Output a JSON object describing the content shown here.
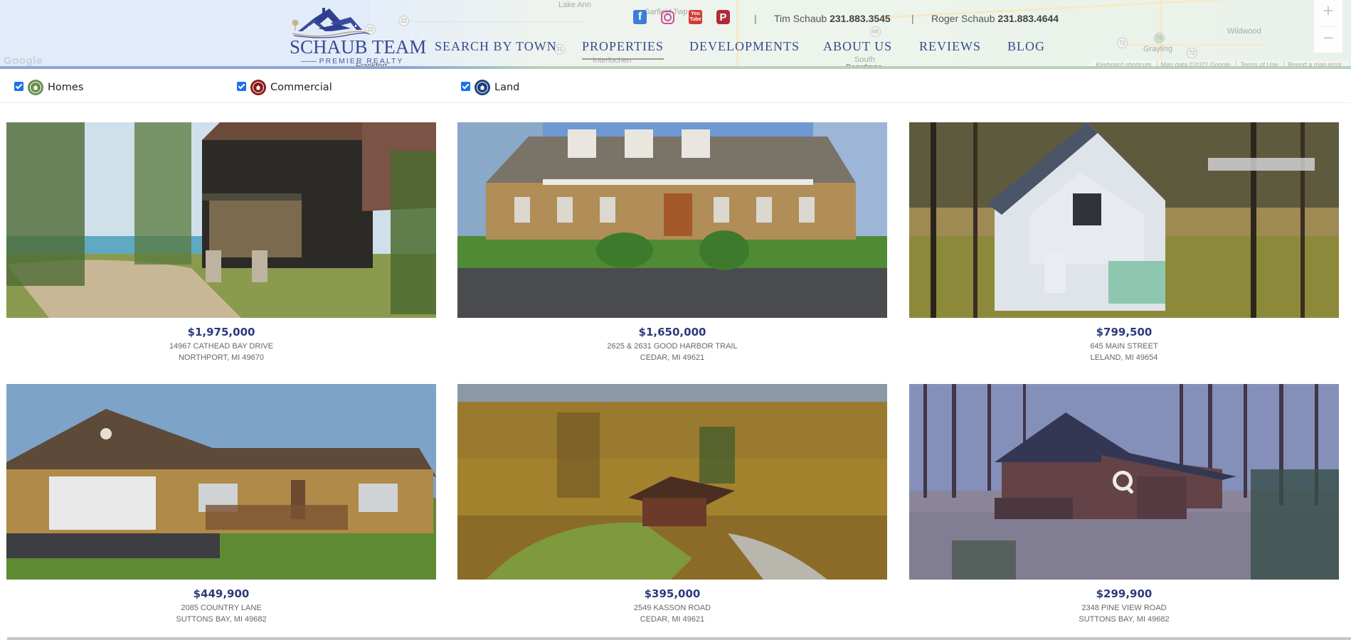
{
  "map": {
    "labels": [
      "Lake Ann",
      "Garfield Twp",
      "Interlochen",
      "Frankfort",
      "South",
      "Boardman",
      "Grayling",
      "Wildwood"
    ],
    "routes": [
      "22",
      "22",
      "31",
      "66",
      "72",
      "72",
      "75"
    ],
    "zoom_in": "+",
    "zoom_out": "−",
    "attribution": [
      "Keyboard shortcuts",
      "Map data ©2022 Google",
      "Terms of Use",
      "Report a map error"
    ],
    "provider_logo": "Google"
  },
  "brand": {
    "title": "SCHAUB TEAM",
    "subtitle": "PREMIER REALTY",
    "primary_color": "#3a4a8e"
  },
  "social": [
    {
      "name": "facebook",
      "glyph": "f",
      "color": "#3b7dd8"
    },
    {
      "name": "instagram",
      "glyph": "",
      "color": "#c94e9c"
    },
    {
      "name": "youtube",
      "glyph": "You Tube",
      "color": "#d23b33"
    },
    {
      "name": "pinterest",
      "glyph": "P",
      "color": "#b02a3a"
    }
  ],
  "contacts": [
    {
      "name": "Tim Schaub",
      "phone": "231.883.3545"
    },
    {
      "name": "Roger Schaub",
      "phone": "231.883.4644"
    }
  ],
  "separator": "|",
  "nav": [
    {
      "label": "SEARCH BY TOWN",
      "active": false
    },
    {
      "label": "PROPERTIES",
      "active": true
    },
    {
      "label": "DEVELOPMENTS",
      "active": false
    },
    {
      "label": "ABOUT US",
      "active": false
    },
    {
      "label": "REVIEWS",
      "active": false
    },
    {
      "label": "BLOG",
      "active": false
    }
  ],
  "filters": [
    {
      "label": "Homes",
      "checked": true,
      "color": "#6a8f4e"
    },
    {
      "label": "Commercial",
      "checked": true,
      "color": "#8b1a1a"
    },
    {
      "label": "Land",
      "checked": true,
      "color": "#1e3f7a"
    }
  ],
  "listings": [
    {
      "price": "$1,975,000",
      "address": "14967 CATHEAD BAY DRIVE",
      "city": "NORTHPORT, MI 49670",
      "photo": "log-home-lakefront",
      "hover": false
    },
    {
      "price": "$1,650,000",
      "address": "2625 & 2631 GOOD HARBOR TRAIL",
      "city": "CEDAR, MI 49621",
      "photo": "cape-cod-home-dormers",
      "hover": false
    },
    {
      "price": "$799,500",
      "address": "645 MAIN STREET",
      "city": "LELAND, MI 49654",
      "photo": "white-a-frame-garage",
      "hover": false
    },
    {
      "price": "$449,900",
      "address": "2085 COUNTRY LANE",
      "city": "SUTTONS BAY, MI 49682",
      "photo": "ranch-home-garage",
      "hover": false
    },
    {
      "price": "$395,000",
      "address": "2549 KASSON ROAD",
      "city": "CEDAR, MI 49621",
      "photo": "aerial-cabin-autumn-woods",
      "hover": false
    },
    {
      "price": "$299,900",
      "address": "2348 PINE VIEW ROAD",
      "city": "SUTTONS BAY, MI 49682",
      "photo": "wood-cabin-bare-trees",
      "hover": true
    }
  ],
  "icons": {
    "hover_overlay": "magnifier-icon",
    "filter_marker": "house-marker-icon"
  }
}
